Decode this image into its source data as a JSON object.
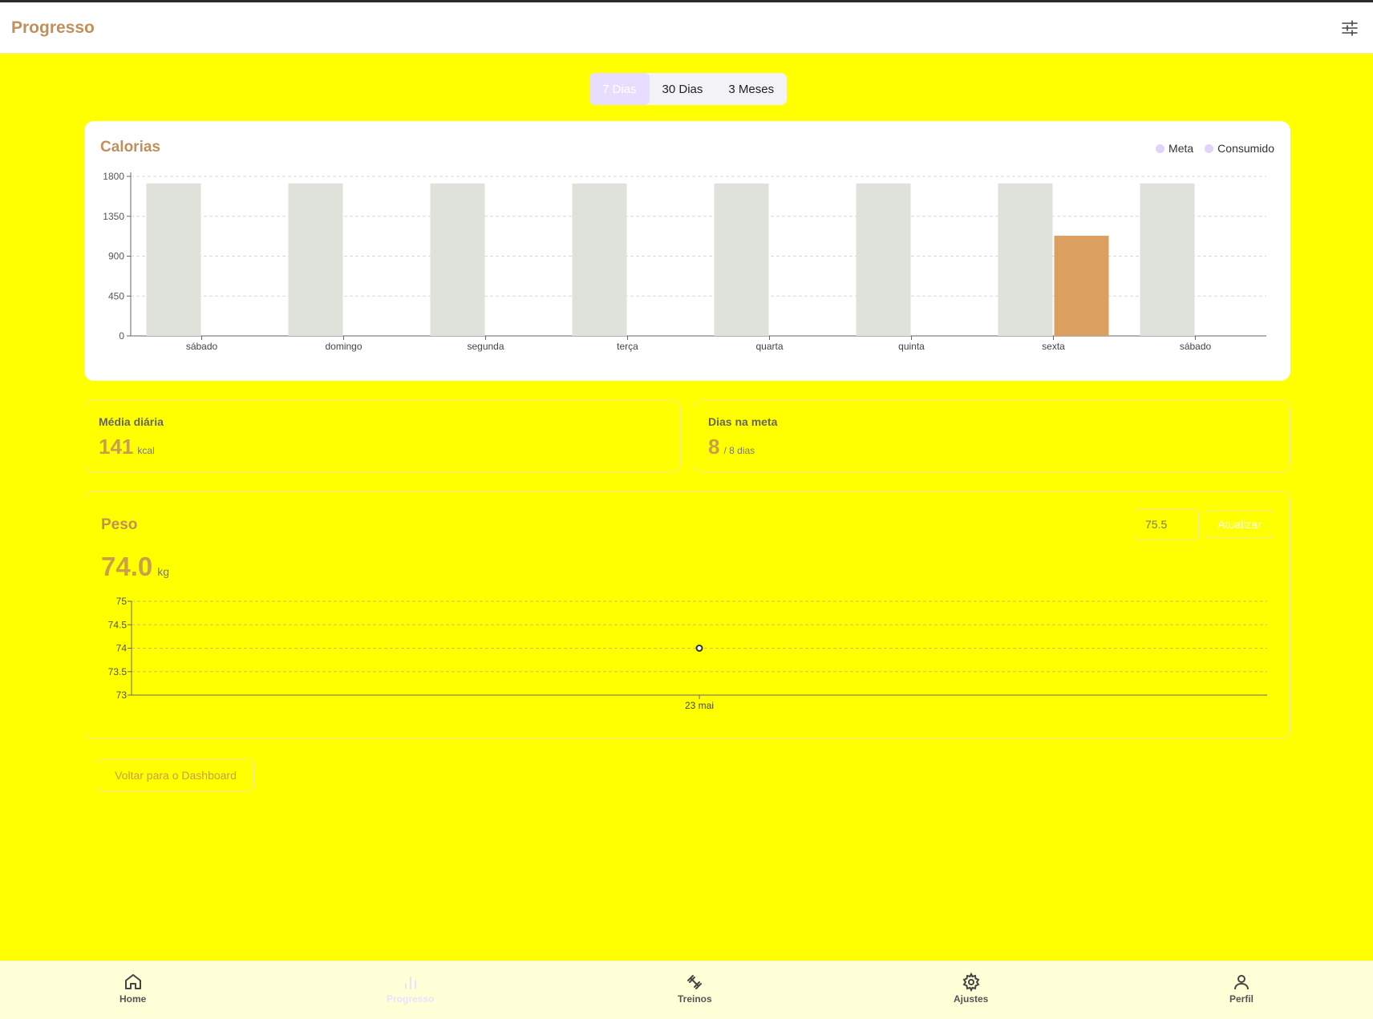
{
  "header": {
    "title": "Progresso",
    "filter_icon": "sliders-icon"
  },
  "period_tabs": [
    {
      "label": "7 Dias",
      "active": true
    },
    {
      "label": "30 Dias",
      "active": false
    },
    {
      "label": "3 Meses",
      "active": false
    }
  ],
  "calorias": {
    "title": "Calorias",
    "legend": [
      "Meta",
      "Consumido"
    ]
  },
  "stats": {
    "media": {
      "label": "Média diária",
      "value": "141",
      "unit": "kcal"
    },
    "meta": {
      "label": "Dias na meta",
      "value": "8",
      "unit": "/ 8 dias"
    }
  },
  "peso": {
    "title": "Peso",
    "input_placeholder": "75.5",
    "update_label": "Atualizar",
    "current_value": "74.0",
    "unit": "kg"
  },
  "back_label": "Voltar para o Dashboard",
  "nav": [
    {
      "label": "Home",
      "icon": "home-icon",
      "active": false
    },
    {
      "label": "Progresso",
      "icon": "bar-chart-icon",
      "active": true
    },
    {
      "label": "Treinos",
      "icon": "dumbbell-icon",
      "active": false
    },
    {
      "label": "Ajustes",
      "icon": "gear-icon",
      "active": false
    },
    {
      "label": "Perfil",
      "icon": "user-icon",
      "active": false
    }
  ],
  "colors": {
    "background": "#ffff00",
    "meta_bar": "#dfe2da",
    "consumido_bar": "#dba05f",
    "accent_title": "#c0905a"
  },
  "chart_data": [
    {
      "type": "bar",
      "title": "Calorias",
      "categories": [
        "sábado",
        "domingo",
        "segunda",
        "terça",
        "quarta",
        "quinta",
        "sexta",
        "sábado"
      ],
      "series": [
        {
          "name": "Meta",
          "values": [
            1720,
            1720,
            1720,
            1720,
            1720,
            1720,
            1720,
            1720
          ]
        },
        {
          "name": "Consumido",
          "values": [
            0,
            0,
            0,
            0,
            0,
            0,
            1130,
            0
          ]
        }
      ],
      "yticks": [
        0,
        450,
        900,
        1350,
        1800
      ],
      "ylim": [
        0,
        1800
      ],
      "grid": true,
      "legend": "top-right"
    },
    {
      "type": "scatter",
      "title": "Peso",
      "x": [
        "23 mai"
      ],
      "y": [
        74
      ],
      "yticks": [
        73,
        73.5,
        74,
        74.5,
        75
      ],
      "ylim": [
        73,
        75
      ],
      "grid": true
    }
  ]
}
